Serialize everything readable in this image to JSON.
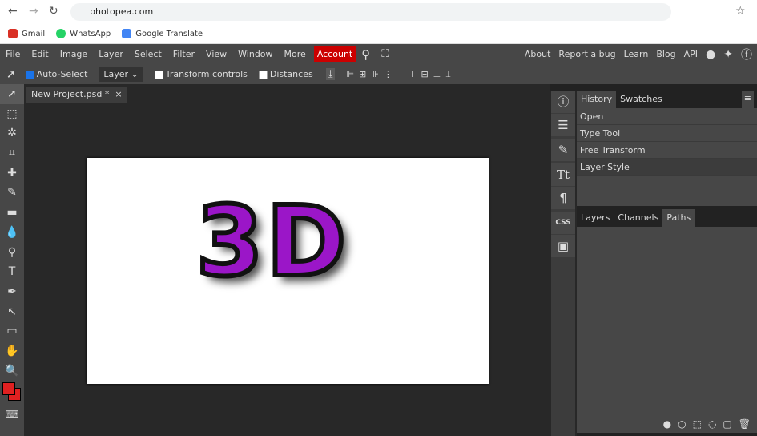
{
  "browser": {
    "url": "photopea.com",
    "bookmarks": [
      {
        "label": "Gmail",
        "color": "#d93025"
      },
      {
        "label": "WhatsApp",
        "color": "#25d366"
      },
      {
        "label": "Google Translate",
        "color": "#4285f4"
      }
    ]
  },
  "menu": {
    "items": [
      "File",
      "Edit",
      "Image",
      "Layer",
      "Select",
      "Filter",
      "View",
      "Window",
      "More"
    ],
    "account": "Account",
    "right": [
      "About",
      "Report a bug",
      "Learn",
      "Blog",
      "API"
    ]
  },
  "options": {
    "auto_select": "Auto-Select",
    "layer_select": "Layer",
    "transform_controls": "Transform controls",
    "distances": "Distances"
  },
  "document": {
    "tab": "New Project.psd *",
    "close": "×",
    "canvas_text": "3D",
    "text_color": "#9b16c8"
  },
  "colors": {
    "foreground": "#e02020",
    "background": "#e02020"
  },
  "panels": {
    "top_tabs": [
      "History",
      "Swatches"
    ],
    "history": [
      "Open",
      "Type Tool",
      "Free Transform",
      "Layer Style"
    ],
    "bottom_tabs": [
      "Layers",
      "Channels",
      "Paths"
    ],
    "css_label": "CSS"
  }
}
